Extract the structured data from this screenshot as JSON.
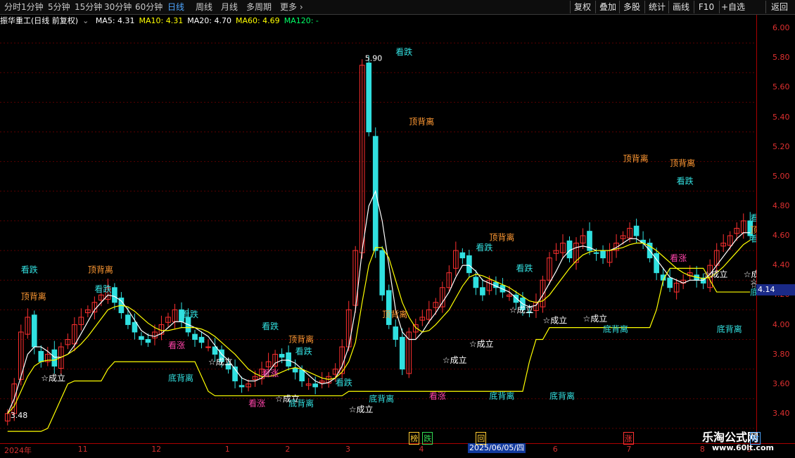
{
  "toolbar": {
    "periods": [
      "分时",
      "1分钟",
      "5分钟",
      "15分钟",
      "30分钟",
      "60分钟",
      "日线",
      "周线",
      "月线",
      "多周期",
      "更多"
    ],
    "active": "日线",
    "buttons": [
      "复权",
      "叠加",
      "多股",
      "统计",
      "画线",
      "F10",
      "+自选",
      "返回"
    ]
  },
  "header": {
    "title": "振华重工(日线 前复权)",
    "ma": [
      {
        "label": "MA5: 4.31",
        "color": "#ffffff"
      },
      {
        "label": "MA10: 4.31",
        "color": "#ffff00"
      },
      {
        "label": "MA20: 4.70",
        "color": "#ffffff"
      },
      {
        "label": "MA60: 4.69",
        "color": "#ffff00"
      },
      {
        "label": "MA120: -",
        "color": "#00ff66"
      }
    ]
  },
  "chart_data": {
    "type": "candlestick",
    "ylim": [
      3.3,
      6.1
    ],
    "yticks": [
      "6.00",
      "5.80",
      "5.60",
      "5.40",
      "5.20",
      "5.00",
      "4.80",
      "4.60",
      "4.40",
      "4.20",
      "4.00",
      "3.80",
      "3.60",
      "3.40"
    ],
    "ytick_values": [
      6.0,
      5.8,
      5.6,
      5.4,
      5.2,
      5.0,
      4.8,
      4.6,
      4.4,
      4.2,
      4.0,
      3.8,
      3.6,
      3.4
    ],
    "current_price": "4.14",
    "high_label": "5.90",
    "low_label": "3.48",
    "closes": [
      3.5,
      3.7,
      4.05,
      4.15,
      3.95,
      3.85,
      3.9,
      3.82,
      3.95,
      4.0,
      4.1,
      4.15,
      4.2,
      4.25,
      4.3,
      4.35,
      4.25,
      4.18,
      4.1,
      4.05,
      4.0,
      3.98,
      4.05,
      4.1,
      4.15,
      4.2,
      4.12,
      4.05,
      4.0,
      3.98,
      3.95,
      3.9,
      3.85,
      3.8,
      3.72,
      3.68,
      3.7,
      3.75,
      3.8,
      3.85,
      3.9,
      3.88,
      3.82,
      3.78,
      3.72,
      3.7,
      3.68,
      3.72,
      3.75,
      3.8,
      3.95,
      4.2,
      4.6,
      5.85,
      5.4,
      4.6,
      4.3,
      4.1,
      4.0,
      3.8,
      4.05,
      4.1,
      4.15,
      4.2,
      4.25,
      4.35,
      4.45,
      4.6,
      4.55,
      4.45,
      4.35,
      4.3,
      4.4,
      4.35,
      4.32,
      4.3,
      4.25,
      4.2,
      4.18,
      4.25,
      4.4,
      4.55,
      4.6,
      4.65,
      4.55,
      4.65,
      4.7,
      4.6,
      4.58,
      4.55,
      4.6,
      4.65,
      4.7,
      4.75,
      4.7,
      4.65,
      4.55,
      4.45,
      4.4,
      4.35,
      4.38,
      4.4,
      4.45,
      4.4,
      4.38,
      4.5,
      4.6,
      4.65,
      4.7,
      4.75,
      4.8,
      4.7
    ],
    "ma_lines": [
      {
        "name": "MA5",
        "color": "#ffffff",
        "values": [
          3.5,
          3.6,
          3.75,
          3.9,
          3.95,
          3.95,
          3.92,
          3.88,
          3.88,
          3.9,
          3.96,
          4.04,
          4.12,
          4.2,
          4.25,
          4.3,
          4.29,
          4.26,
          4.2,
          4.13,
          4.06,
          4.03,
          4.02,
          4.04,
          4.08,
          4.12,
          4.12,
          4.1,
          4.08,
          4.05,
          4.02,
          3.96,
          3.9,
          3.86,
          3.8,
          3.74,
          3.72,
          3.72,
          3.74,
          3.78,
          3.84,
          3.86,
          3.86,
          3.84,
          3.8,
          3.76,
          3.72,
          3.7,
          3.71,
          3.74,
          3.82,
          3.95,
          4.2,
          4.6,
          4.9,
          5.0,
          4.8,
          4.5,
          4.2,
          4.05,
          4.0,
          4.0,
          4.05,
          4.12,
          4.18,
          4.25,
          4.32,
          4.42,
          4.5,
          4.5,
          4.46,
          4.4,
          4.38,
          4.36,
          4.34,
          4.32,
          4.28,
          4.24,
          4.22,
          4.23,
          4.3,
          4.38,
          4.46,
          4.55,
          4.6,
          4.62,
          4.63,
          4.62,
          4.6,
          4.6,
          4.6,
          4.62,
          4.65,
          4.68,
          4.68,
          4.65,
          4.6,
          4.54,
          4.48,
          4.42,
          4.4,
          4.38,
          4.4,
          4.4,
          4.4,
          4.44,
          4.5,
          4.56,
          4.62,
          4.68,
          4.72,
          4.72
        ]
      },
      {
        "name": "MA10",
        "color": "#ffff00",
        "values": [
          3.5,
          3.55,
          3.65,
          3.75,
          3.82,
          3.85,
          3.86,
          3.86,
          3.88,
          3.9,
          3.93,
          3.97,
          4.02,
          4.08,
          4.14,
          4.2,
          4.22,
          4.23,
          4.22,
          4.19,
          4.15,
          4.11,
          4.08,
          4.06,
          4.06,
          4.07,
          4.08,
          4.08,
          4.08,
          4.07,
          4.05,
          4.02,
          3.98,
          3.94,
          3.9,
          3.85,
          3.8,
          3.77,
          3.75,
          3.75,
          3.76,
          3.78,
          3.8,
          3.81,
          3.8,
          3.78,
          3.76,
          3.74,
          3.73,
          3.74,
          3.78,
          3.85,
          3.98,
          4.25,
          4.5,
          4.62,
          4.62,
          4.55,
          4.4,
          4.25,
          4.15,
          4.08,
          4.05,
          4.06,
          4.1,
          4.15,
          4.2,
          4.28,
          4.36,
          4.42,
          4.44,
          4.43,
          4.41,
          4.39,
          4.37,
          4.35,
          4.32,
          4.29,
          4.26,
          4.25,
          4.26,
          4.3,
          4.36,
          4.42,
          4.48,
          4.53,
          4.57,
          4.59,
          4.6,
          4.6,
          4.6,
          4.61,
          4.62,
          4.64,
          4.65,
          4.65,
          4.63,
          4.6,
          4.56,
          4.52,
          4.48,
          4.45,
          4.43,
          4.42,
          4.41,
          4.42,
          4.45,
          4.49,
          4.54,
          4.59,
          4.64,
          4.67
        ]
      },
      {
        "name": "MA60",
        "color": "#ffff00",
        "values": [
          3.38,
          3.38,
          3.38,
          3.38,
          3.38,
          3.38,
          3.4,
          3.5,
          3.6,
          3.7,
          3.72,
          3.72,
          3.72,
          3.72,
          3.72,
          3.8,
          3.85,
          3.85,
          3.85,
          3.85,
          3.85,
          3.85,
          3.85,
          3.85,
          3.85,
          3.85,
          3.85,
          3.85,
          3.85,
          3.75,
          3.65,
          3.62,
          3.62,
          3.62,
          3.62,
          3.62,
          3.62,
          3.62,
          3.62,
          3.62,
          3.62,
          3.62,
          3.62,
          3.62,
          3.62,
          3.62,
          3.62,
          3.62,
          3.62,
          3.62,
          3.62,
          3.65,
          3.65,
          3.65,
          3.65,
          3.65,
          3.65,
          3.65,
          3.65,
          3.65,
          3.65,
          3.65,
          3.65,
          3.65,
          3.65,
          3.65,
          3.65,
          3.65,
          3.65,
          3.65,
          3.65,
          3.65,
          3.65,
          3.65,
          3.65,
          3.65,
          3.65,
          3.65,
          3.85,
          4.0,
          4.0,
          4.08,
          4.08,
          4.08,
          4.08,
          4.08,
          4.08,
          4.08,
          4.08,
          4.08,
          4.08,
          4.08,
          4.08,
          4.08,
          4.08,
          4.08,
          4.08,
          4.2,
          4.4,
          4.48,
          4.48,
          4.48,
          4.48,
          4.48,
          4.48,
          4.4,
          4.32,
          4.32,
          4.32,
          4.32,
          4.32,
          4.32
        ]
      }
    ],
    "annotations": [
      {
        "text": "看跌",
        "color": "#33e0e0",
        "x": 2,
        "y": 4.45
      },
      {
        "text": "顶背离",
        "color": "#ff9933",
        "x": 2,
        "y": 4.27
      },
      {
        "text": "顶背离",
        "color": "#ff9933",
        "x": 12,
        "y": 4.45
      },
      {
        "text": "看跌",
        "color": "#33e0e0",
        "x": 13,
        "y": 4.32
      },
      {
        "text": "☆成立",
        "color": "#ffffff",
        "x": 5,
        "y": 3.72
      },
      {
        "text": "底背离",
        "color": "#33e0e0",
        "x": 24,
        "y": 3.72
      },
      {
        "text": "看跌",
        "color": "#33e0e0",
        "x": 26,
        "y": 4.15
      },
      {
        "text": "看跌",
        "color": "#33e0e0",
        "x": 38,
        "y": 4.07
      },
      {
        "text": "☆成立",
        "color": "#ffffff",
        "x": 30,
        "y": 3.83
      },
      {
        "text": "看涨",
        "color": "#ff44aa",
        "x": 24,
        "y": 3.94
      },
      {
        "text": "顶背离",
        "color": "#ff9933",
        "x": 42,
        "y": 3.98
      },
      {
        "text": "看跌",
        "color": "#33e0e0",
        "x": 43,
        "y": 3.9
      },
      {
        "text": "看涨",
        "color": "#ff44aa",
        "x": 38,
        "y": 3.75
      },
      {
        "text": "☆成立",
        "color": "#ffffff",
        "x": 40,
        "y": 3.58
      },
      {
        "text": "底背离",
        "color": "#33e0e0",
        "x": 42,
        "y": 3.55
      },
      {
        "text": "看涨",
        "color": "#ff44aa",
        "x": 36,
        "y": 3.55
      },
      {
        "text": "看跌",
        "color": "#33e0e0",
        "x": 49,
        "y": 3.69
      },
      {
        "text": "☆成立",
        "color": "#ffffff",
        "x": 51,
        "y": 3.51
      },
      {
        "text": "底背离",
        "color": "#33e0e0",
        "x": 54,
        "y": 3.58
      },
      {
        "text": "顶背离",
        "color": "#ff9933",
        "x": 56,
        "y": 4.15
      },
      {
        "text": "看跌",
        "color": "#33e0e0",
        "x": 58,
        "y": 5.92
      },
      {
        "text": "顶背离",
        "color": "#ff9933",
        "x": 60,
        "y": 5.45
      },
      {
        "text": "看跌",
        "color": "#33e0e0",
        "x": 70,
        "y": 4.6
      },
      {
        "text": "顶背离",
        "color": "#ff9933",
        "x": 72,
        "y": 4.67
      },
      {
        "text": "☆成立",
        "color": "#ffffff",
        "x": 69,
        "y": 3.95
      },
      {
        "text": "☆成立",
        "color": "#ffffff",
        "x": 65,
        "y": 3.84
      },
      {
        "text": "底背离",
        "color": "#33e0e0",
        "x": 72,
        "y": 3.6
      },
      {
        "text": "看涨",
        "color": "#ff44aa",
        "x": 63,
        "y": 3.6
      },
      {
        "text": "☆成立",
        "color": "#ffffff",
        "x": 75,
        "y": 4.18
      },
      {
        "text": "看跌",
        "color": "#33e0e0",
        "x": 76,
        "y": 4.46
      },
      {
        "text": "底背离",
        "color": "#33e0e0",
        "x": 81,
        "y": 3.6
      },
      {
        "text": "顶背离",
        "color": "#ff9933",
        "x": 92,
        "y": 5.2
      },
      {
        "text": "顶背离",
        "color": "#ff9933",
        "x": 99,
        "y": 5.17
      },
      {
        "text": "看跌",
        "color": "#33e0e0",
        "x": 100,
        "y": 5.05
      },
      {
        "text": "☆成立",
        "color": "#ffffff",
        "x": 80,
        "y": 4.11
      },
      {
        "text": "☆成立",
        "color": "#ffffff",
        "x": 86,
        "y": 4.12
      },
      {
        "text": "底背离",
        "color": "#33e0e0",
        "x": 89,
        "y": 4.05
      },
      {
        "text": "看涨",
        "color": "#ff44aa",
        "x": 99,
        "y": 4.53
      },
      {
        "text": "☆成立",
        "color": "#ffffff",
        "x": 104,
        "y": 4.42
      },
      {
        "text": "底背离",
        "color": "#33e0e0",
        "x": 106,
        "y": 4.05
      },
      {
        "text": "看跌",
        "color": "#33e0e0",
        "x": 111,
        "y": 4.8
      },
      {
        "text": "☆成立",
        "color": "#ffffff",
        "x": 110,
        "y": 4.42
      },
      {
        "text": "☆成立",
        "color": "#ffffff",
        "x": 116,
        "y": 4.37
      },
      {
        "text": "看跌",
        "color": "#33e0e0",
        "x": 120,
        "y": 4.66
      },
      {
        "text": "☆成立",
        "color": "#ffffff",
        "x": 123,
        "y": 4.35
      },
      {
        "text": "顶背离",
        "color": "#ff9933",
        "x": 128,
        "y": 4.72
      },
      {
        "text": "底背离",
        "color": "#33e0e0",
        "x": 127,
        "y": 4.3
      }
    ],
    "x_labels": [
      {
        "text": "2024年",
        "x": 0
      },
      {
        "text": "11",
        "x": 11
      },
      {
        "text": "12",
        "x": 22
      },
      {
        "text": "1",
        "x": 33
      },
      {
        "text": "2",
        "x": 42
      },
      {
        "text": "3",
        "x": 51
      },
      {
        "text": "4",
        "x": 62
      },
      {
        "text": "5",
        "x": 72
      },
      {
        "text": "6",
        "x": 82
      },
      {
        "text": "7",
        "x": 93
      },
      {
        "text": "8",
        "x": 104
      },
      {
        "text": "9",
        "x": 115
      }
    ],
    "event_marks": [
      {
        "text": "榜",
        "color": "#ffcc33",
        "x": 60
      },
      {
        "text": "跌",
        "color": "#33dd55",
        "x": 62
      },
      {
        "text": "回",
        "color": "#ffcc33",
        "x": 70
      },
      {
        "text": "涨",
        "color": "#ff3333",
        "x": 92
      },
      {
        "text": "财",
        "color": "#4ea6ff",
        "x": 114
      }
    ],
    "date_tooltip": "2025/06/05/四"
  },
  "watermark": {
    "main": "乐淘公式网",
    "url": "www.60lt.com"
  }
}
